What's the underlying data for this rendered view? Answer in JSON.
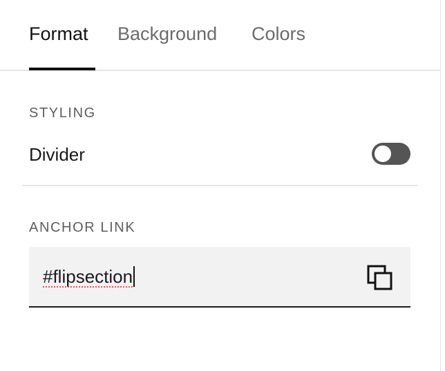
{
  "tabs": [
    {
      "label": "Format",
      "active": true
    },
    {
      "label": "Background",
      "active": false
    },
    {
      "label": "Colors",
      "active": false
    }
  ],
  "styling": {
    "heading": "STYLING",
    "divider_label": "Divider",
    "divider_enabled": false
  },
  "anchor": {
    "heading": "ANCHOR LINK",
    "value": "#flipsection",
    "copy_icon": "copy-icon"
  },
  "colors": {
    "active_tab": "#111111",
    "inactive_tab": "#6b6b6b",
    "toggle_off": "#555555",
    "field_bg": "#f2f2f2",
    "spellcheck_underline": "#e05555"
  }
}
